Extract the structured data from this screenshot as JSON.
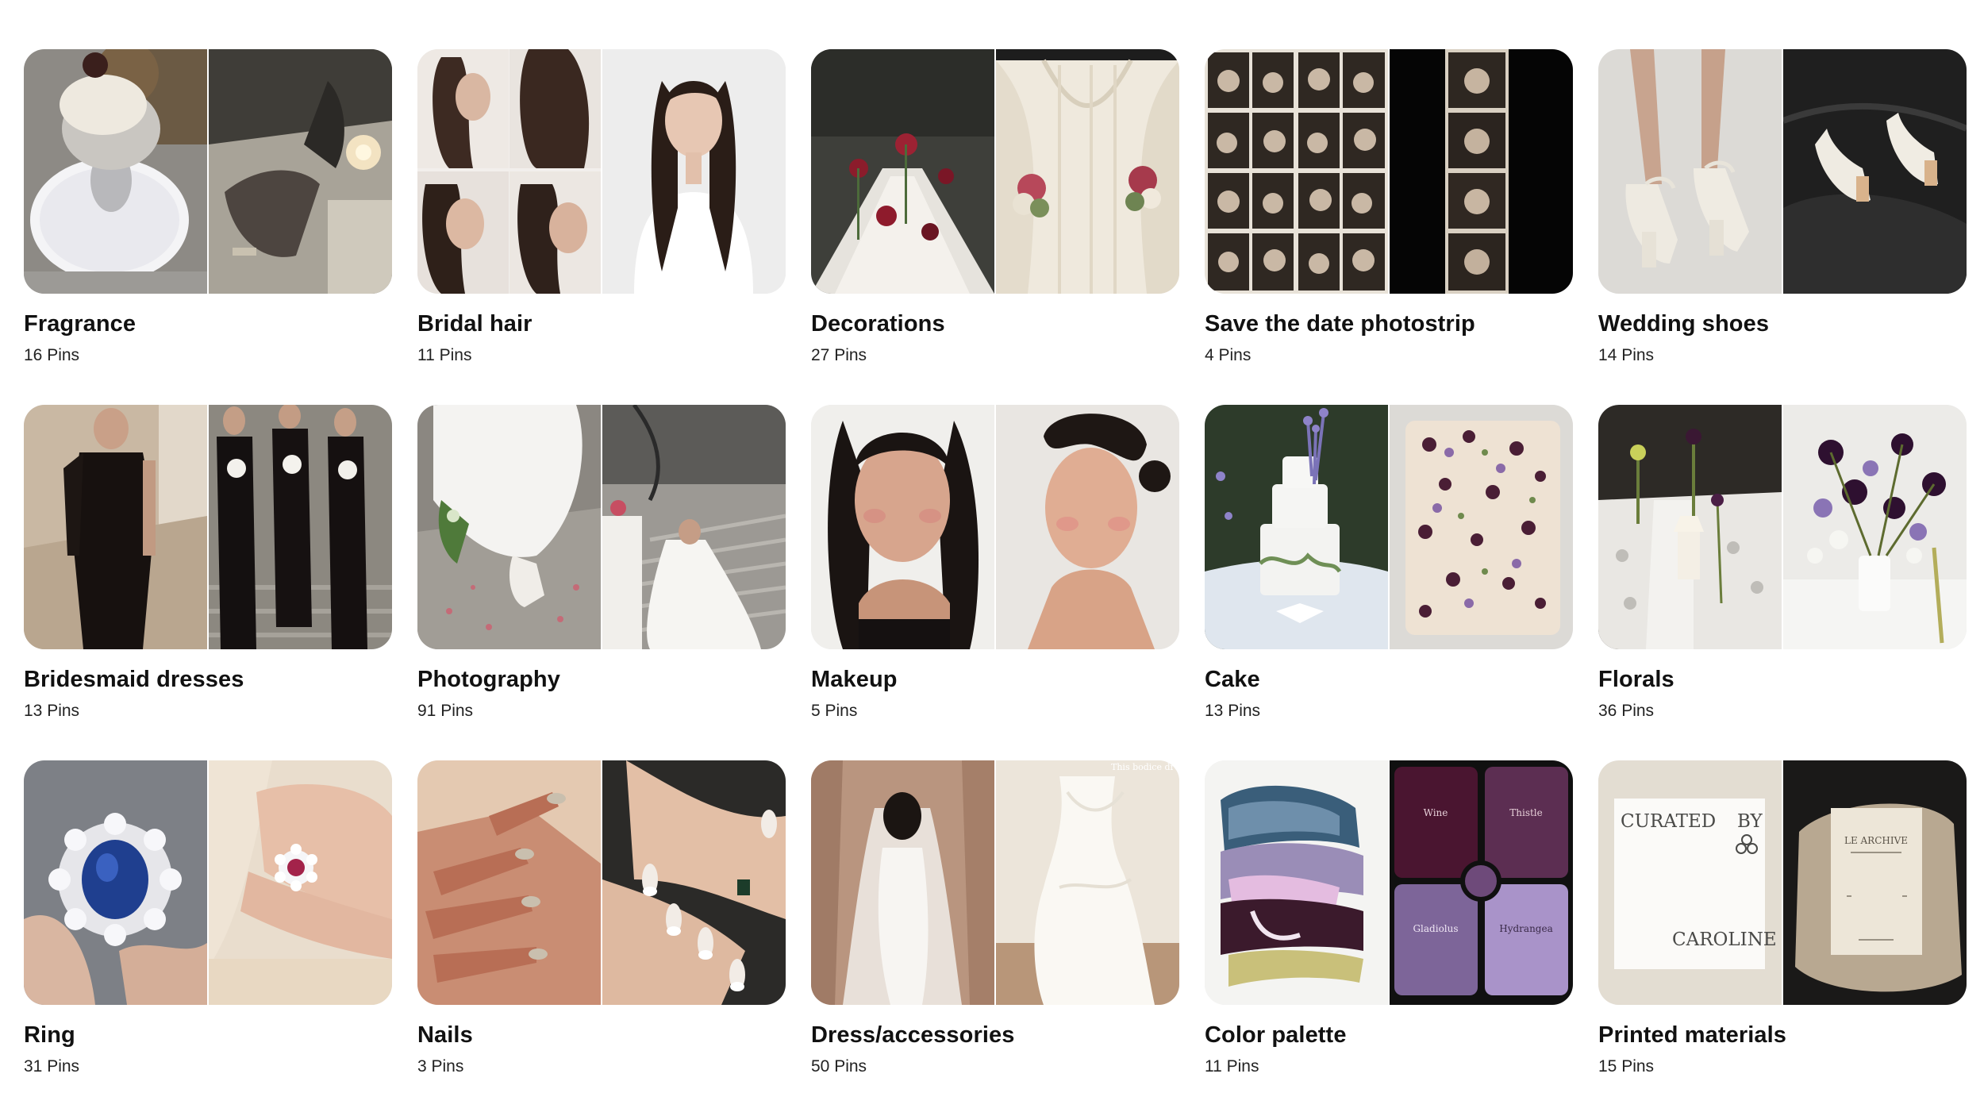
{
  "boards": [
    {
      "title": "Fragrance",
      "pins": "16 Pins",
      "left_image": "ice-cream-dessert-on-doily",
      "right_image": "candlelit-dinner-hands"
    },
    {
      "title": "Bridal hair",
      "pins": "11 Pins",
      "left_image": "hairstyle-collage",
      "right_image": "bride-white-dress-long-hair"
    },
    {
      "title": "Decorations",
      "pins": "27 Pins",
      "left_image": "long-reception-table-flowers",
      "right_image": "draped-fabric-backdrop"
    },
    {
      "title": "Save the date photostrip",
      "pins": "4 Pins",
      "left_image": "photobooth-grid",
      "right_image": "photostrip-on-black"
    },
    {
      "title": "Wedding shoes",
      "pins": "14 Pins",
      "left_image": "white-heels-worn",
      "right_image": "white-heels-on-leather"
    },
    {
      "title": "Bridesmaid dresses",
      "pins": "13 Pins",
      "left_image": "black-one-shoulder-dress",
      "right_image": "bridesmaids-on-stairs"
    },
    {
      "title": "Photography",
      "pins": "91 Pins",
      "left_image": "bride-dress-hem-petals",
      "right_image": "bride-on-staircase"
    },
    {
      "title": "Makeup",
      "pins": "5 Pins",
      "left_image": "soft-glam-portrait",
      "right_image": "sleek-bun-portrait"
    },
    {
      "title": "Cake",
      "pins": "13 Pins",
      "left_image": "tiered-cake-lavender",
      "right_image": "sheet-cake-pressed-flowers"
    },
    {
      "title": "Florals",
      "pins": "36 Pins",
      "left_image": "tablescape-candles",
      "right_image": "purple-calla-arrangement"
    },
    {
      "title": "Ring",
      "pins": "31 Pins",
      "left_image": "sapphire-cluster-ring",
      "right_image": "ruby-cluster-ring-on-hand"
    },
    {
      "title": "Nails",
      "pins": "3 Pins",
      "left_image": "chrome-tip-nails",
      "right_image": "french-tip-nails"
    },
    {
      "title": "Dress/accessories",
      "pins": "50 Pins",
      "left_image": "bride-veil-back",
      "right_image": "draped-white-gown"
    },
    {
      "title": "Color palette",
      "pins": "11 Pins",
      "left_image": "paint-swatch-strokes",
      "right_image": "purple-palette-cards"
    },
    {
      "title": "Printed materials",
      "pins": "15 Pins",
      "left_image": "curated-card",
      "right_image": "le-archive-booklet"
    }
  ],
  "image_text": {
    "curated_card": {
      "top_left": "CURATED",
      "top_right": "BY",
      "bottom": "CAROLINE"
    },
    "booklet": {
      "title": "LE ARCHIVE"
    },
    "palette": {
      "c1": "Wine",
      "c2": "Thistle",
      "c3": "Gladiolus",
      "c4": "Hydrangea"
    },
    "gown_caption": "This bodice dre"
  },
  "colors": {
    "background": "#ffffff",
    "title_text": "#111111",
    "count_text": "#222222"
  }
}
